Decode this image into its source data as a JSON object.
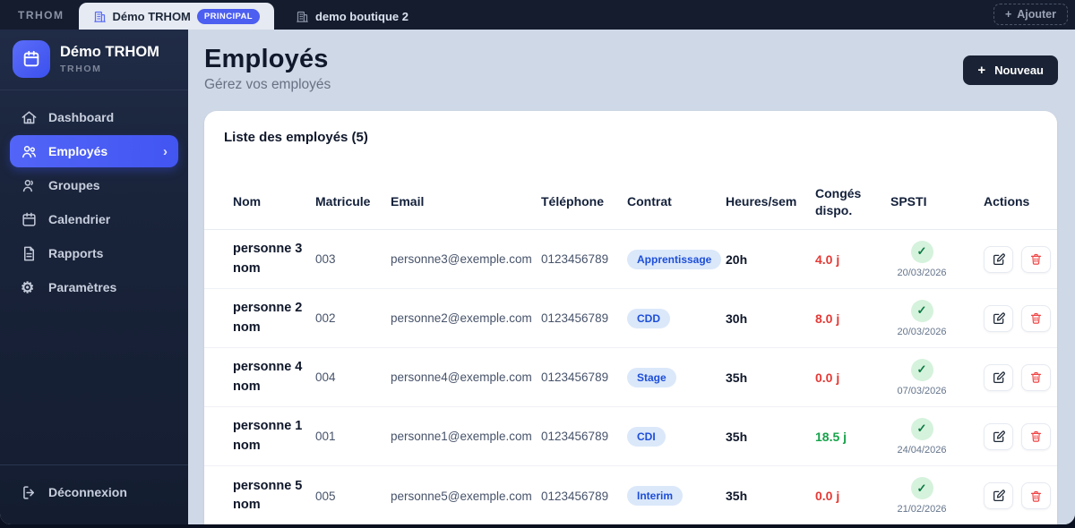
{
  "colors": {
    "accent_blue": "#4a5ef5",
    "topbar_bg": "#141c2e",
    "sidebar_bg": "#19233a",
    "main_bg": "#cfd8e6",
    "badge_contract_bg": "#dbe8fa",
    "badge_contract_text": "#1d4ed8",
    "conges_low": "#e53935",
    "conges_ok": "#16a34a",
    "spsti_ok_bg": "#d5f2dc",
    "spsti_ok_check": "#0d7a43"
  },
  "icons": {
    "plus": "+",
    "check": "✓",
    "chevron_right": "›"
  },
  "topbar": {
    "brand": "TRHOM",
    "tabs": [
      {
        "label": "Démo TRHOM",
        "badge": "PRINCIPAL",
        "active": true
      },
      {
        "label": "demo boutique 2",
        "active": false
      }
    ],
    "add_button_label": "Ajouter"
  },
  "sidebar": {
    "logo_title": "Démo TRHOM",
    "logo_subtitle": "TRHOM",
    "items": [
      {
        "label": "Dashboard",
        "active": false
      },
      {
        "label": "Employés",
        "active": true
      },
      {
        "label": "Groupes",
        "active": false
      },
      {
        "label": "Calendrier",
        "active": false
      },
      {
        "label": "Rapports",
        "active": false
      },
      {
        "label": "Paramètres",
        "active": false
      }
    ],
    "logout_label": "Déconnexion"
  },
  "header": {
    "title": "Employés",
    "subtitle": "Gérez vos employés",
    "new_button_label": "Nouveau"
  },
  "table": {
    "title": "Liste des employés (5)",
    "headers": [
      "Nom",
      "Matricule",
      "Email",
      "Téléphone",
      "Contrat",
      "Heures/sem",
      "Congés dispo.",
      "SPSTI",
      "Actions"
    ],
    "rows": [
      {
        "name": "personne 3 nom",
        "matricule": "003",
        "email": "personne3@exemple.com",
        "phone": "0123456789",
        "contract": "Apprentissage",
        "hours": "20h",
        "conges": "4.0 j",
        "conges_status": "low",
        "spsti_date": "20/03/2026"
      },
      {
        "name": "personne 2 nom",
        "matricule": "002",
        "email": "personne2@exemple.com",
        "phone": "0123456789",
        "contract": "CDD",
        "hours": "30h",
        "conges": "8.0 j",
        "conges_status": "low",
        "spsti_date": "20/03/2026"
      },
      {
        "name": "personne 4 nom",
        "matricule": "004",
        "email": "personne4@exemple.com",
        "phone": "0123456789",
        "contract": "Stage",
        "hours": "35h",
        "conges": "0.0 j",
        "conges_status": "low",
        "spsti_date": "07/03/2026"
      },
      {
        "name": "personne 1 nom",
        "matricule": "001",
        "email": "personne1@exemple.com",
        "phone": "0123456789",
        "contract": "CDI",
        "hours": "35h",
        "conges": "18.5 j",
        "conges_status": "ok",
        "spsti_date": "24/04/2026"
      },
      {
        "name": "personne 5 nom",
        "matricule": "005",
        "email": "personne5@exemple.com",
        "phone": "0123456789",
        "contract": "Interim",
        "hours": "35h",
        "conges": "0.0 j",
        "conges_status": "low",
        "spsti_date": "21/02/2026"
      }
    ]
  }
}
